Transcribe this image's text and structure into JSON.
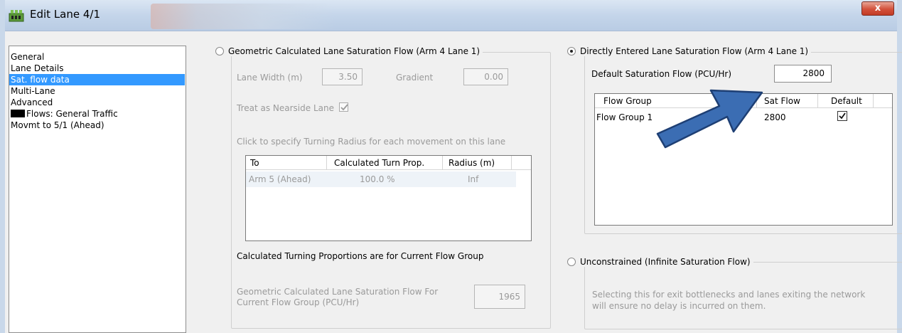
{
  "window": {
    "title": "Edit Lane 4/1",
    "close_symbol": "x"
  },
  "left_list": {
    "items": [
      {
        "label": "General",
        "selected": false
      },
      {
        "label": "Lane Details",
        "selected": false
      },
      {
        "label": "Sat. flow data",
        "selected": true
      },
      {
        "label": "Multi-Lane",
        "selected": false
      },
      {
        "label": "Advanced",
        "selected": false
      },
      {
        "label": "Flows: General Traffic",
        "selected": false,
        "swatch": "#000000"
      },
      {
        "label": "Movmt to 5/1 (Ahead)",
        "selected": false
      }
    ]
  },
  "geometric": {
    "legend": "Geometric Calculated Lane Saturation Flow (Arm 4 Lane 1)",
    "selected": false,
    "lane_width_label": "Lane Width (m)",
    "lane_width_value": "3.50",
    "gradient_label": "Gradient",
    "gradient_value": "0.00",
    "nearside_label": "Treat as Nearside Lane",
    "nearside_checked": true,
    "turning_hint": "Click to specify Turning Radius for each movement on this lane",
    "turn_table": {
      "columns": [
        "To",
        "Calculated Turn Prop.",
        "Radius (m)"
      ],
      "rows": [
        {
          "to": "Arm 5 (Ahead)",
          "prop": "100.0 %",
          "radius": "Inf"
        }
      ]
    },
    "turning_note": "Calculated Turning Proportions are for Current Flow Group",
    "result_label_line1": "Geometric Calculated Lane Saturation Flow For",
    "result_label_line2": "Current Flow Group (PCU/Hr)",
    "result_value": "1965"
  },
  "direct": {
    "legend": "Directly Entered Lane Saturation Flow (Arm 4 Lane 1)",
    "selected": true,
    "default_label": "Default Saturation Flow (PCU/Hr)",
    "default_value": "2800",
    "flow_table": {
      "columns": [
        "Flow Group",
        "Sat Flow",
        "Default"
      ],
      "rows": [
        {
          "group": "Flow Group 1",
          "sat_flow": "2800",
          "default_checked": true
        }
      ]
    }
  },
  "unconstrained": {
    "legend": "Unconstrained (Infinite Saturation Flow)",
    "selected": false,
    "desc_line1": "Selecting this for exit bottlenecks and lanes exiting the network",
    "desc_line2": "will ensure no delay is incurred on them."
  },
  "colors": {
    "selection": "#3399ff",
    "arrow_fill": "#3b6db3",
    "arrow_stroke": "#1e3f74"
  }
}
